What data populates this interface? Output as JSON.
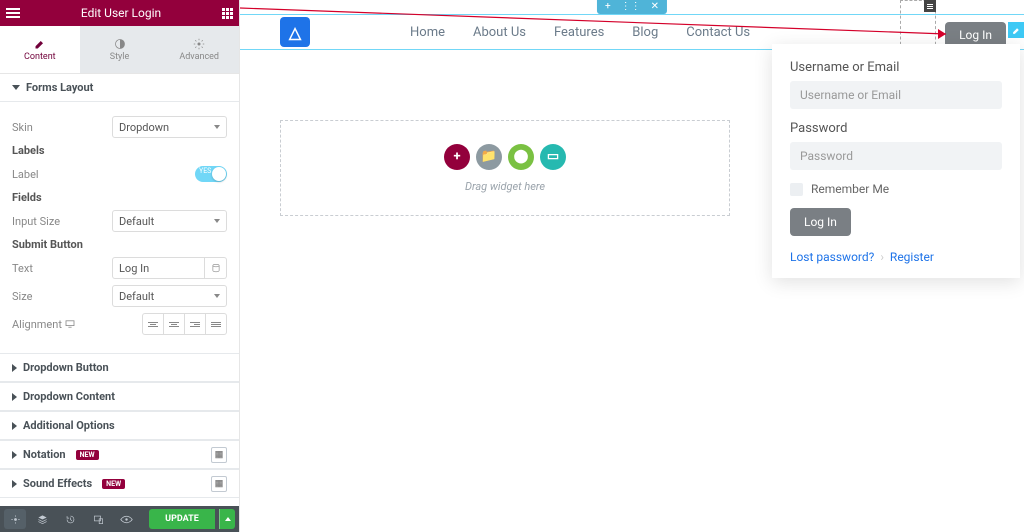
{
  "panel": {
    "title": "Edit User Login",
    "tabs": {
      "content": "Content",
      "style": "Style",
      "advanced": "Advanced"
    },
    "sections": {
      "forms_layout": "Forms Layout",
      "dropdown_button": "Dropdown Button",
      "dropdown_content": "Dropdown Content",
      "additional_options": "Additional Options",
      "notation": "Notation",
      "sound_effects": "Sound Effects"
    },
    "badge_new": "NEW",
    "controls": {
      "skin_label": "Skin",
      "skin_value": "Dropdown",
      "labels_head": "Labels",
      "label_row": "Label",
      "toggle_on": "YES",
      "fields_head": "Fields",
      "input_size_label": "Input Size",
      "input_size_value": "Default",
      "submit_head": "Submit Button",
      "text_label": "Text",
      "text_value": "Log In",
      "size_label": "Size",
      "size_value": "Default",
      "alignment_label": "Alignment"
    },
    "footer": {
      "update": "UPDATE"
    }
  },
  "preview": {
    "nav": {
      "home": "Home",
      "about": "About Us",
      "features": "Features",
      "blog": "Blog",
      "contact": "Contact Us"
    },
    "login_button": "Log In",
    "dropzone": {
      "text": "Drag widget here"
    },
    "card": {
      "user_label": "Username or Email",
      "user_placeholder": "Username or Email",
      "pass_label": "Password",
      "pass_placeholder": "Password",
      "remember": "Remember Me",
      "submit": "Log In",
      "lost": "Lost password?",
      "register": "Register"
    }
  }
}
